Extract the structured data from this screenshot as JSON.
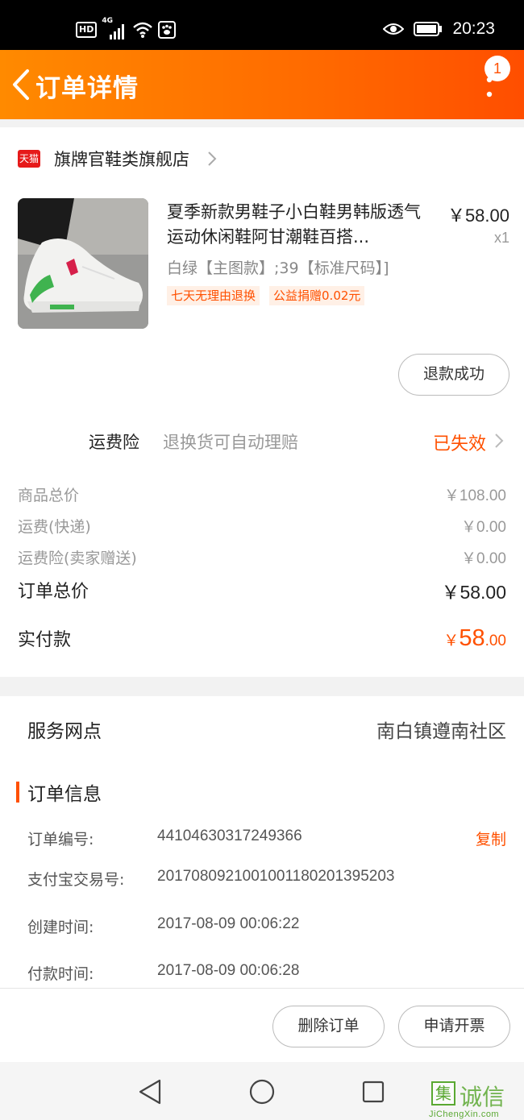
{
  "status_bar": {
    "hd": "HD",
    "network": "4G",
    "time": "20:23"
  },
  "header": {
    "title": "订单详情",
    "badge_count": "1"
  },
  "shop": {
    "platform_icon": "天猫",
    "name": "旗牌官鞋类旗舰店"
  },
  "product": {
    "title": "夏季新款男鞋子小白鞋男韩版透气运动休闲鞋阿甘潮鞋百搭...",
    "price": "￥58.00",
    "quantity": "x1",
    "sku": "白绿【主图款】;39【标准尺码】]",
    "tags": [
      "七天无理由退换",
      "公益捐赠0.02元"
    ]
  },
  "refund_button": "退款成功",
  "insurance": {
    "label": "运费险",
    "desc": "退换货可自动理赔",
    "status": "已失效"
  },
  "prices": {
    "goods_total_label": "商品总价",
    "goods_total_value": "￥108.00",
    "shipping_label": "运费(快递)",
    "shipping_value": "￥0.00",
    "insurance_label": "运费险(卖家赠送)",
    "insurance_value": "￥0.00",
    "order_total_label": "订单总价",
    "order_total_value": "￥58.00",
    "paid_label": "实付款",
    "paid_currency": "￥",
    "paid_int": "58",
    "paid_dec": ".00"
  },
  "service": {
    "label": "服务网点",
    "value": "南白镇遵南社区"
  },
  "order_info": {
    "title": "订单信息",
    "order_no_label": "订单编号:",
    "order_no_value": "44104630317249366",
    "copy_label": "复制",
    "alipay_label": "支付宝交易号:",
    "alipay_value": "2017080921001001180201395203",
    "created_label": "创建时间:",
    "created_value": "2017-08-09 00:06:22",
    "paid_time_label": "付款时间:",
    "paid_time_value": "2017-08-09 00:06:28"
  },
  "actions": {
    "delete": "删除订单",
    "invoice": "申请开票"
  },
  "watermark": {
    "mark": "集",
    "text": "诚信",
    "url": "JiChengXin.com"
  },
  "colors": {
    "accent": "#ff5000",
    "header_start": "#ff8a00",
    "header_end": "#ff4e00"
  }
}
